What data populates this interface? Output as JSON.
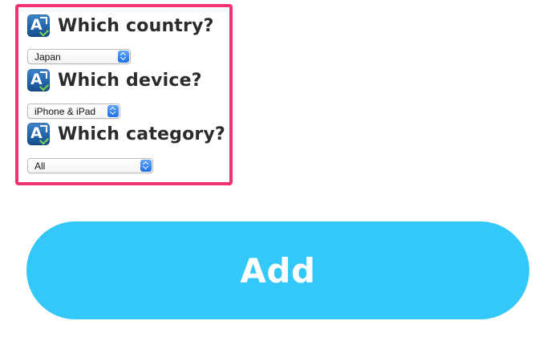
{
  "form": {
    "country": {
      "title": "Which country?",
      "selected": "Japan"
    },
    "device": {
      "title": "Which device?",
      "selected": "iPhone & iPad"
    },
    "category": {
      "title": "Which category?",
      "selected": "All"
    }
  },
  "actions": {
    "add_label": "Add"
  },
  "colors": {
    "highlight_border": "#f0336f",
    "add_button": "#34c8f9",
    "stepper_blue": "#1f6fe6"
  },
  "icons": {
    "field_icon": "app-store-icon",
    "select_arrows": "chevron-up-down-icon"
  }
}
